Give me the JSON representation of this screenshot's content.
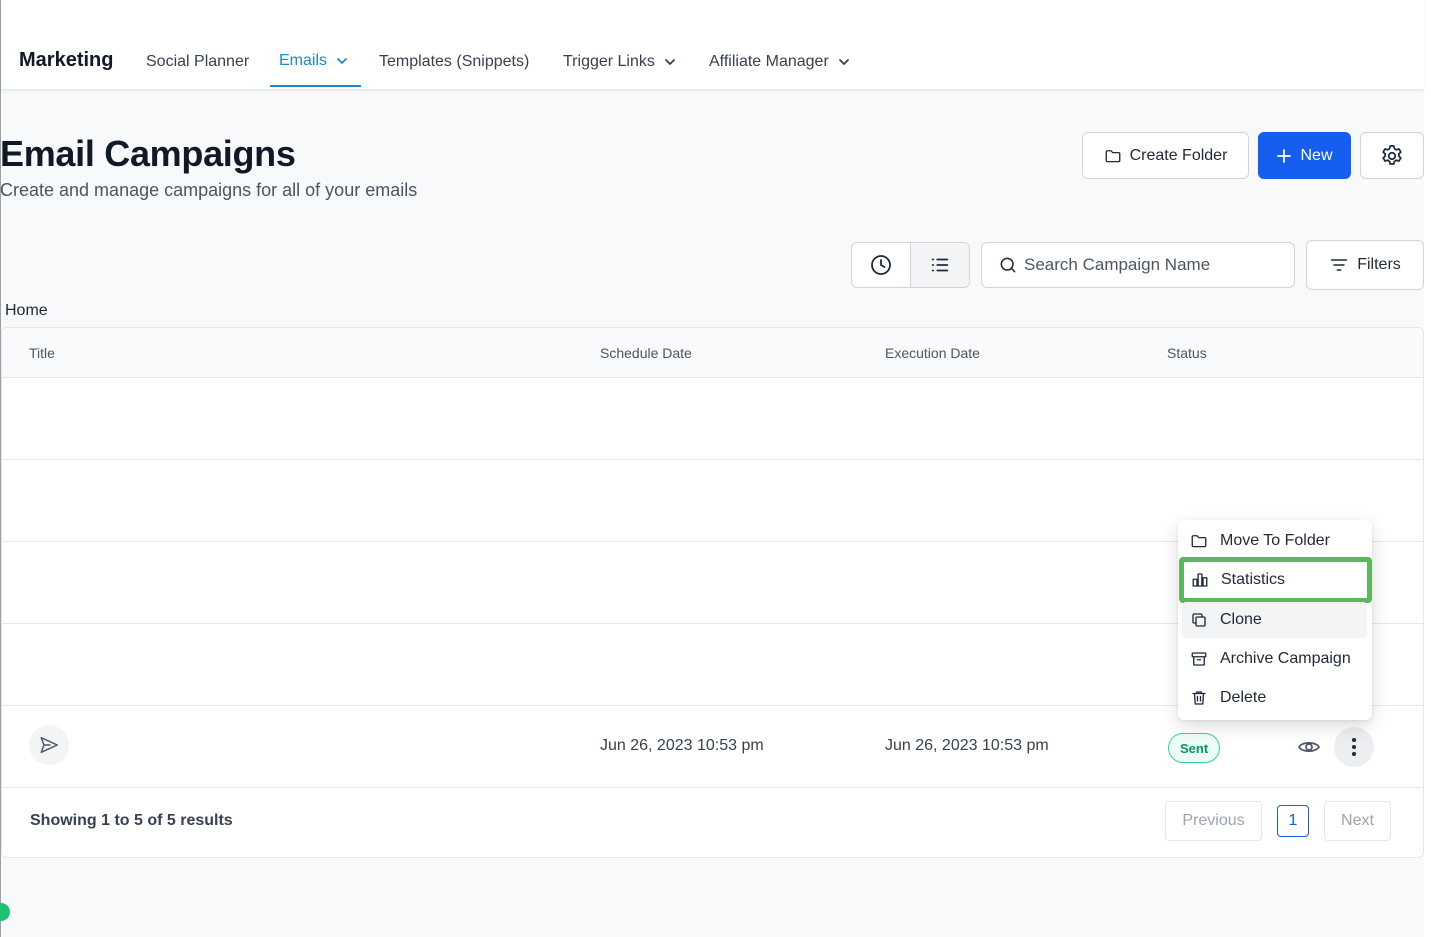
{
  "nav": {
    "brand": "Marketing",
    "items": [
      {
        "label": "Social Planner"
      },
      {
        "label": "Emails"
      },
      {
        "label": "Templates (Snippets)"
      },
      {
        "label": "Trigger Links"
      },
      {
        "label": "Affiliate Manager"
      }
    ],
    "active": "Emails"
  },
  "header": {
    "title": "Email Campaigns",
    "subtitle": "Create and manage campaigns for all of your emails",
    "create_folder_label": "Create Folder",
    "new_label": "New"
  },
  "toolbar": {
    "search_placeholder": "Search Campaign Name",
    "filters_label": "Filters"
  },
  "breadcrumb": "Home",
  "table": {
    "columns": [
      "Title",
      "Schedule Date",
      "Execution Date",
      "Status"
    ],
    "rows": [
      {
        "schedule_date": "",
        "execution_date": "",
        "status": ""
      },
      {
        "schedule_date": "",
        "execution_date": "",
        "status": ""
      },
      {
        "schedule_date": "",
        "execution_date": "",
        "status": ""
      },
      {
        "schedule_date": "",
        "execution_date": "",
        "status": ""
      },
      {
        "schedule_date": "Jun 26, 2023 10:53 pm",
        "execution_date": "Jun 26, 2023 10:53 pm",
        "status": "Sent"
      }
    ],
    "footer": "Showing 1 to 5 of 5 results"
  },
  "pagination": {
    "previous": "Previous",
    "current_page": "1",
    "next": "Next"
  },
  "row_menu": {
    "items": [
      {
        "label": "Move To Folder",
        "icon": "folder-icon"
      },
      {
        "label": "Statistics",
        "icon": "bar-chart-icon"
      },
      {
        "label": "Clone",
        "icon": "copy-icon"
      },
      {
        "label": "Archive Campaign",
        "icon": "archive-icon"
      },
      {
        "label": "Delete",
        "icon": "trash-icon"
      }
    ],
    "highlighted": "Statistics",
    "hovered": "Clone"
  },
  "colors": {
    "primary": "#155eef",
    "active_nav": "#1e88c8",
    "status_sent": "#059669",
    "highlight_border": "#5cb85c"
  }
}
